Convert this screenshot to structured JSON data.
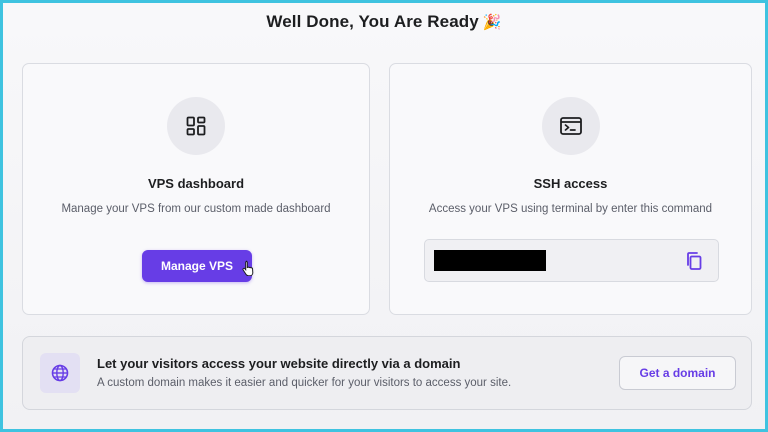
{
  "header": {
    "title": "Well Done, You Are Ready",
    "emoji": "🎉"
  },
  "vps_card": {
    "icon": "dashboard-grid-icon",
    "title": "VPS dashboard",
    "description": "Manage your VPS from our custom made dashboard",
    "button_label": "Manage VPS"
  },
  "ssh_card": {
    "icon": "terminal-icon",
    "title": "SSH access",
    "description": "Access your VPS using terminal by enter this command",
    "command_redacted": true,
    "copy_icon": "copy-icon"
  },
  "domain_banner": {
    "icon": "globe-icon",
    "title": "Let your visitors access your website directly via a domain",
    "description": "A custom domain makes it easier and quicker for your visitors to access your site.",
    "button_label": "Get a domain"
  },
  "colors": {
    "accent": "#673de6",
    "frame_border": "#3fc3e0"
  }
}
